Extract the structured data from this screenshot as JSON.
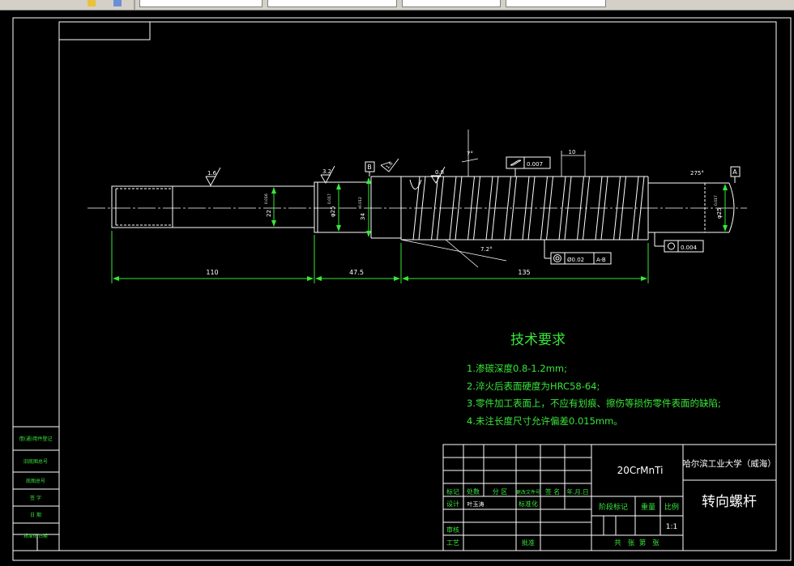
{
  "colors": {
    "background": "#000000",
    "line": "#ffffff",
    "dimension": "#39e639",
    "text": "#ffffff"
  },
  "dimensions": {
    "len_110": "110",
    "len_47_5": "47.5",
    "len_135": "135",
    "pitch_10": "10",
    "diam_22": "22",
    "diam_25_left": "25",
    "diam_34": "34",
    "diam_25_right": "25",
    "tol_22": "0.016",
    "tol_25_left": "0.017",
    "tol_34": "0.012",
    "tol_25_right": "0.017",
    "angle_7": "7°",
    "angle_275": "275°",
    "lead_angle": "7.2°"
  },
  "roughness": {
    "r1": "1.6",
    "r2": "3.2",
    "r3": "1.6",
    "r4": "0.8"
  },
  "datums": {
    "b": "B",
    "a": "A"
  },
  "tolerance_frames": {
    "flatness_value": "0.007",
    "runout_value": "0.02",
    "runout_datum": "A-B",
    "circularity_value": "0.004"
  },
  "notes": {
    "title": "技术要求",
    "items": [
      "1.渗碳深度0.8-1.2mm;",
      "2.淬火后表面硬度为HRC58-64;",
      "3.零件加工表面上，不应有划痕、擦伤等损伤零件表面的缺陷;",
      "4.未注长度尺寸允许偏差0.015mm。"
    ]
  },
  "title_block": {
    "material": "20CrMnTi",
    "school": "哈尔滨工业大学（威海）",
    "part_name": "转向螺杆",
    "scale": "1:1",
    "headers": [
      "标记",
      "处数",
      "分 区",
      "更改文件号",
      "签 名",
      "年.月.日"
    ],
    "design": "设计",
    "designer": "叶玉涛",
    "standard": "标准化",
    "stage": "阶段标记",
    "weight": "重量",
    "ratio": "比例",
    "review": "审核",
    "process": "工艺",
    "approve": "批准",
    "sheets": "共   张  第   张"
  },
  "side_block": {
    "labels": [
      "借(通)用件登记",
      "旧底图总号",
      "底图总号",
      "签 字",
      "日 期",
      "标准化 日期"
    ]
  }
}
